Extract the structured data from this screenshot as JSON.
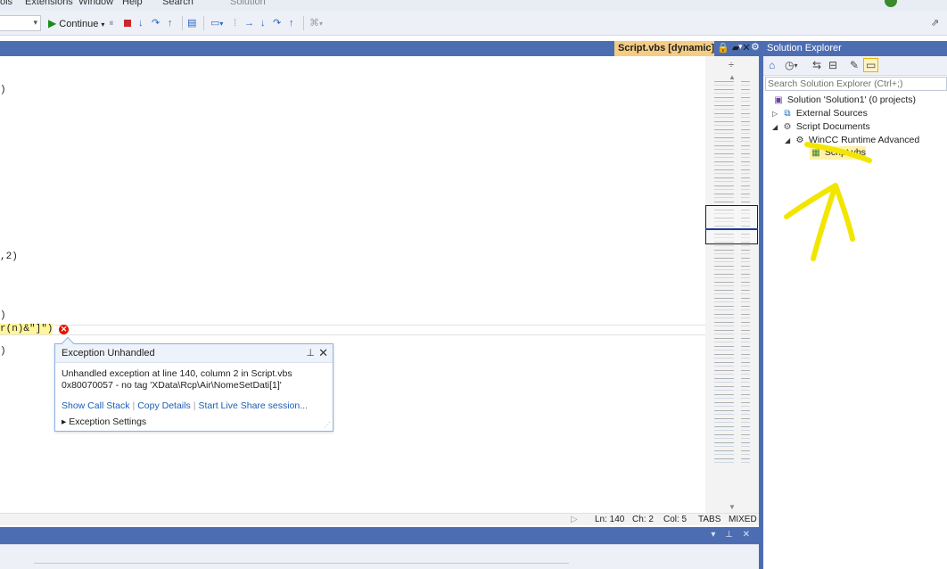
{
  "menubar": {
    "items": [
      "ols",
      "Extensions",
      "Window",
      "Help",
      "Search",
      "Solution"
    ]
  },
  "toolbar": {
    "continue_label": "Continue"
  },
  "document_tab": {
    "title": "Script.vbs [dynamic]"
  },
  "editor": {
    "lines": [
      {
        "text": ")"
      },
      {
        "text": ",2)"
      },
      {
        "text": ")"
      },
      {
        "text": "r(n)&\"]\")"
      },
      {
        "text": ")"
      }
    ]
  },
  "exception_popup": {
    "title": "Exception Unhandled",
    "message_line1": "Unhandled exception at line 140, column 2 in Script.vbs",
    "message_line2": "0x80070057 - no tag 'XData\\Rcp\\Air\\NomeSetDati[1]'",
    "link_call_stack": "Show Call Stack",
    "link_copy_details": "Copy Details",
    "link_live_share": "Start Live Share session...",
    "settings_label": "Exception Settings"
  },
  "status_bar": {
    "ln": "Ln: 140",
    "ch": "Ch: 2",
    "col": "Col: 5",
    "tabs": "TABS",
    "mixed": "MIXED"
  },
  "solution_explorer": {
    "title": "Solution Explorer",
    "search_placeholder": "Search Solution Explorer (Ctrl+;)",
    "tree": [
      {
        "label": "Solution 'Solution1' (0 projects)",
        "icon": "solution-icon"
      },
      {
        "label": "External Sources",
        "icon": "external-sources-icon"
      },
      {
        "label": "Script Documents",
        "icon": "script-documents-icon"
      },
      {
        "label": "WinCC Runtime Advanced",
        "icon": "gear-icon"
      },
      {
        "label": "Script.vbs",
        "icon": "vbs-file-icon"
      }
    ]
  },
  "colors": {
    "accent_blue": "#4d6db3",
    "tab_orange": "#f5cc84",
    "error_red": "#e51400",
    "annotation_yellow": "#f2e600"
  }
}
